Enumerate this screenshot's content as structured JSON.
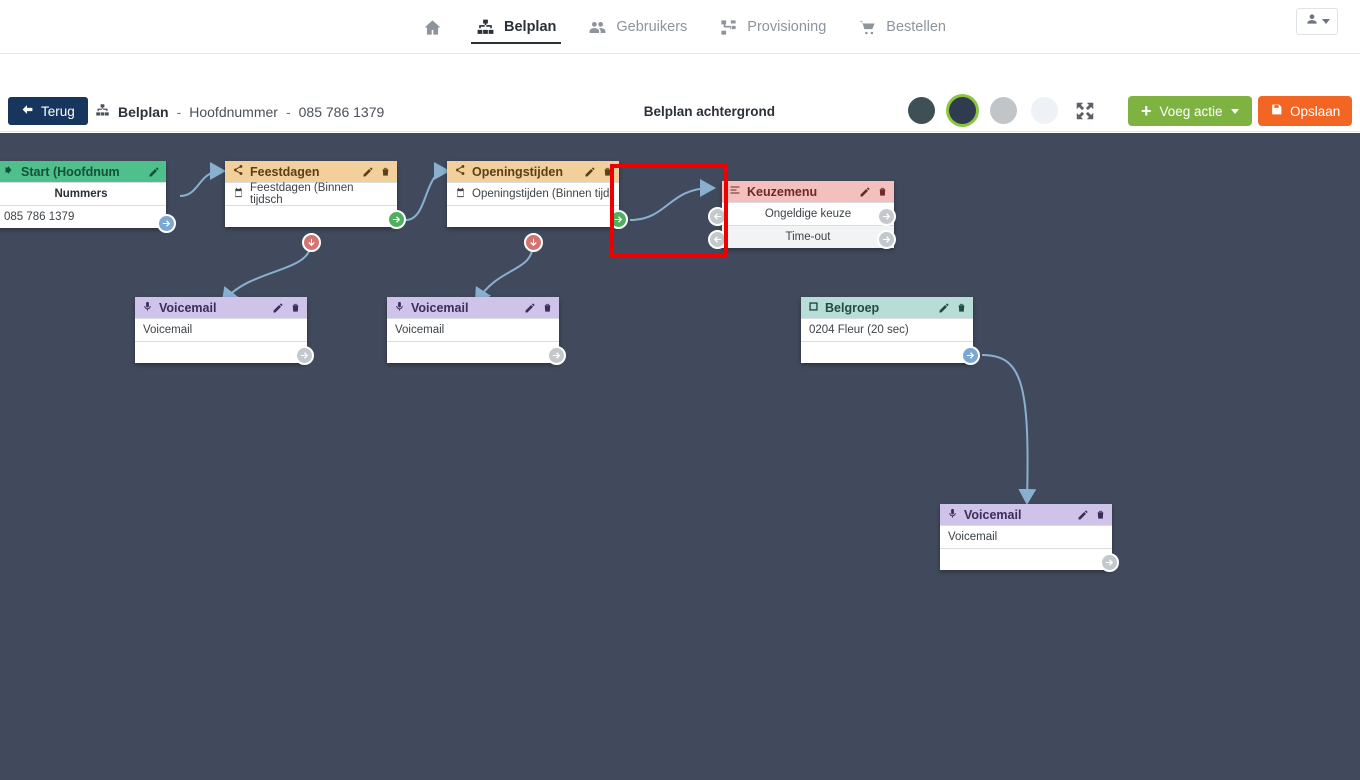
{
  "topnav": {
    "items": [
      {
        "label": "",
        "icon": "home-icon",
        "active": false,
        "name": "home"
      },
      {
        "label": "Belplan",
        "icon": "sitemap-icon",
        "active": true,
        "name": "belplan"
      },
      {
        "label": "Gebruikers",
        "icon": "users-icon",
        "active": false,
        "name": "gebruikers"
      },
      {
        "label": "Provisioning",
        "icon": "provisioning-icon",
        "active": false,
        "name": "provisioning"
      },
      {
        "label": "Bestellen",
        "icon": "cart-icon",
        "active": false,
        "name": "bestellen"
      }
    ],
    "user_menu": {
      "icon": "user-icon",
      "caret": "chevron-down-icon"
    }
  },
  "toolbar": {
    "back_label": "Terug",
    "breadcrumb": {
      "icon": "sitemap-icon",
      "root": "Belplan",
      "sep1": "-",
      "section": "Hoofdnummer",
      "sep2": "-",
      "number": "085 786 1379"
    },
    "background_label": "Belplan achtergrond",
    "swatches": [
      {
        "color": "#3e4f55",
        "selected": false,
        "name": "swatch-dark-teal"
      },
      {
        "color": "#2f3b4e",
        "selected": true,
        "name": "swatch-dark-navy"
      },
      {
        "color": "#c2c5c8",
        "selected": false,
        "name": "swatch-gray"
      },
      {
        "color": "#eef1f5",
        "selected": false,
        "name": "swatch-light"
      }
    ],
    "fullscreen_icon": "fullscreen-icon",
    "add_action_label": "Voeg actie",
    "save_label": "Opslaan",
    "save_icon": "save-icon"
  },
  "canvas": {
    "background_color": "#414a5c",
    "edge_color": "#8ab0d0",
    "highlight_color": "#ee0000"
  },
  "nodes": [
    {
      "id": "start",
      "name": "node-start",
      "title": "Start (Hoofdnum",
      "header_style": "hd-green",
      "icon": "sign-in-icon",
      "actions": [
        "edit-icon"
      ],
      "rows": [
        {
          "text": "Nummers",
          "bold": true,
          "align": "center"
        },
        {
          "text": "085 786 1379",
          "align": "left"
        }
      ]
    },
    {
      "id": "feestdagen",
      "name": "node-feestdagen",
      "title": "Feestdagen",
      "header_style": "hd-orange",
      "icon": "share-icon",
      "actions": [
        "edit-icon",
        "trash-icon"
      ],
      "rows": [
        {
          "text": "Feestdagen (Binnen tijdsch",
          "icon": "calendar-icon",
          "align": "left"
        }
      ]
    },
    {
      "id": "openingstijden",
      "name": "node-openingstijden",
      "title": "Openingstijden",
      "header_style": "hd-orange",
      "icon": "share-icon",
      "actions": [
        "edit-icon",
        "trash-icon"
      ],
      "rows": [
        {
          "text": "Openingstijden (Binnen tijd",
          "icon": "calendar-icon",
          "align": "left"
        }
      ]
    },
    {
      "id": "keuzemenu",
      "name": "node-keuzemenu",
      "title": "Keuzemenu",
      "header_style": "hd-pink",
      "icon": "menu-list-icon",
      "actions": [
        "edit-icon",
        "trash-icon"
      ],
      "rows": [
        {
          "text": "Ongeldige keuze",
          "align": "center"
        },
        {
          "text": "Time-out",
          "align": "center",
          "shaded": true
        }
      ]
    },
    {
      "id": "voicemail1",
      "name": "node-voicemail-1",
      "title": "Voicemail",
      "header_style": "hd-purple",
      "icon": "microphone-icon",
      "actions": [
        "edit-icon",
        "trash-icon"
      ],
      "rows": [
        {
          "text": "Voicemail",
          "align": "left"
        }
      ]
    },
    {
      "id": "voicemail2",
      "name": "node-voicemail-2",
      "title": "Voicemail",
      "header_style": "hd-purple",
      "icon": "microphone-icon",
      "actions": [
        "edit-icon",
        "trash-icon"
      ],
      "rows": [
        {
          "text": "Voicemail",
          "align": "left"
        }
      ]
    },
    {
      "id": "belgroep",
      "name": "node-belgroep",
      "title": "Belgroep",
      "header_style": "hd-mint",
      "icon": "phone-group-icon",
      "actions": [
        "edit-icon",
        "trash-icon"
      ],
      "rows": [
        {
          "text": "0204 Fleur (20 sec)",
          "align": "left"
        }
      ]
    },
    {
      "id": "voicemail3",
      "name": "node-voicemail-3",
      "title": "Voicemail",
      "header_style": "hd-purple",
      "icon": "microphone-icon",
      "actions": [
        "edit-icon",
        "trash-icon"
      ],
      "rows": [
        {
          "text": "Voicemail",
          "align": "left"
        }
      ]
    }
  ]
}
